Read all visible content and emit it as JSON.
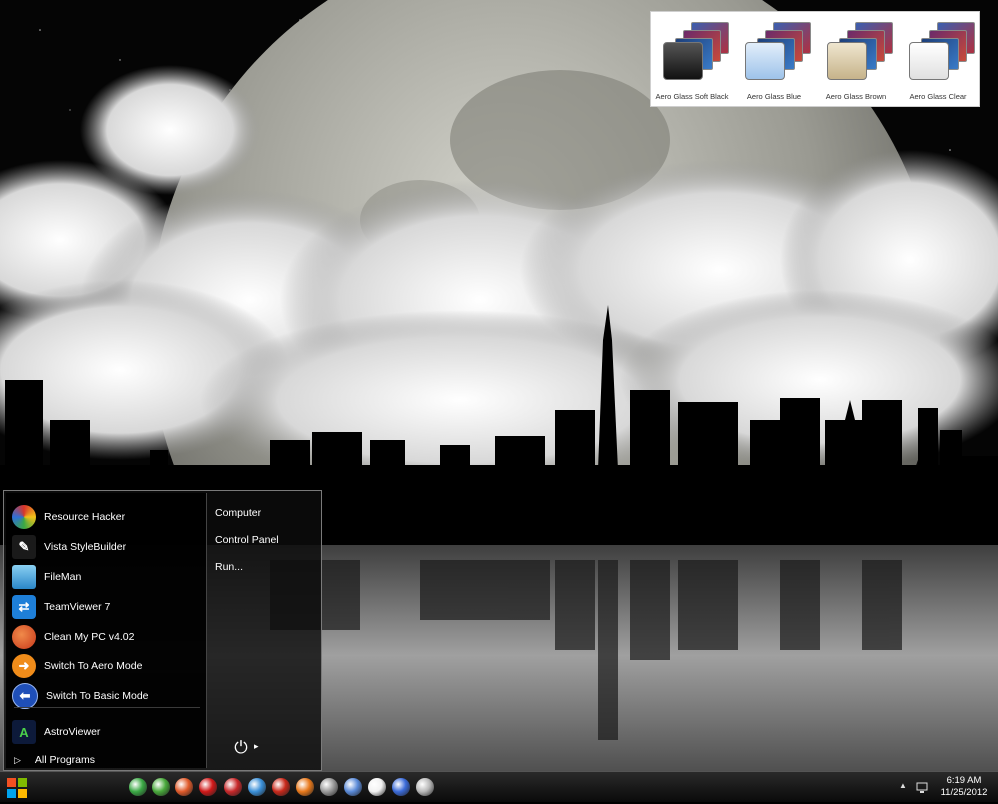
{
  "theme_panel": {
    "themes": [
      {
        "label": "Aero Glass Soft Black",
        "color": "#2a2a2a"
      },
      {
        "label": "Aero Glass Blue",
        "color": "#b9d6f2"
      },
      {
        "label": "Aero Glass Brown",
        "color": "#d8c9a4"
      },
      {
        "label": "Aero Glass Clear",
        "color": "#f2f2f2"
      }
    ]
  },
  "start_menu": {
    "programs": [
      {
        "label": "Resource Hacker",
        "icon": "resource-hacker-icon",
        "color": "#d9342b"
      },
      {
        "label": "Vista StyleBuilder",
        "icon": "vista-stylebuilder-icon",
        "color": "#3c7fd8"
      },
      {
        "label": "FileMan",
        "icon": "fileman-icon",
        "color": "#4aa3d8"
      },
      {
        "label": "TeamViewer 7",
        "icon": "teamviewer-icon",
        "color": "#1e7fd8"
      },
      {
        "label": "Clean My PC v4.02",
        "icon": "clean-my-pc-icon",
        "color": "#e0552a"
      },
      {
        "label": "Switch To Aero Mode",
        "icon": "arrow-right-icon",
        "color": "#f08c1a"
      },
      {
        "label": "Switch To Basic Mode",
        "icon": "arrow-left-icon",
        "color": "#1f4fb8"
      },
      {
        "label": "AstroViewer",
        "icon": "astroviewer-icon",
        "color": "#2e8a3a"
      }
    ],
    "all_programs": "All Programs",
    "right_links": [
      "Computer",
      "Control Panel",
      "Run..."
    ]
  },
  "taskbar": {
    "pinned_icons": [
      {
        "icon": "chrome-icon",
        "color": "#3aa844"
      },
      {
        "icon": "camera-icon",
        "color": "#48a83a"
      },
      {
        "icon": "media-icon",
        "color": "#e05a2a"
      },
      {
        "icon": "opera-icon",
        "color": "#d01818"
      },
      {
        "icon": "record-icon",
        "color": "#c8282a"
      },
      {
        "icon": "safari-icon",
        "color": "#3a8fd8"
      },
      {
        "icon": "acrobat-icon",
        "color": "#c8281a"
      },
      {
        "icon": "firefox-icon",
        "color": "#e8781a"
      },
      {
        "icon": "drive-icon",
        "color": "#9a9a9a"
      },
      {
        "icon": "notepad-icon",
        "color": "#5a8ad8"
      },
      {
        "icon": "runner-icon",
        "color": "#f2f2f2"
      },
      {
        "icon": "network-icon",
        "color": "#3a6ad8"
      },
      {
        "icon": "shield-icon",
        "color": "#b8b8b8"
      }
    ],
    "clock_time": "6:19 AM",
    "clock_date": "11/25/2012"
  }
}
